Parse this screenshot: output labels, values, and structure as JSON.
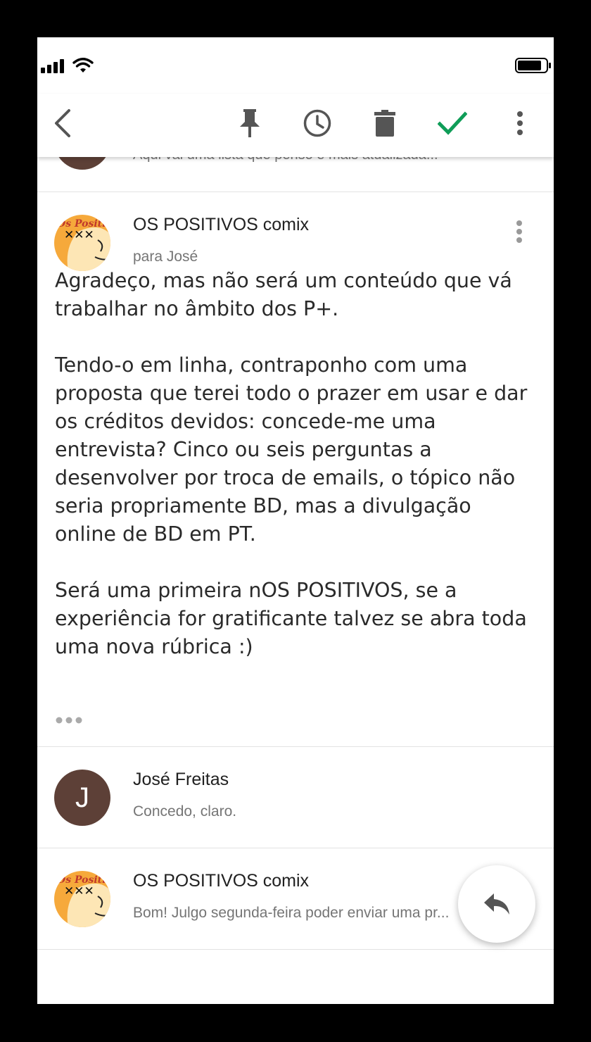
{
  "toolbar": {
    "back_icon": "arrow-back-icon",
    "pin_icon": "pin-icon",
    "snooze_icon": "clock-icon",
    "delete_icon": "trash-icon",
    "done_icon": "check-icon",
    "more_icon": "more-vert-icon",
    "accent": "#0f9d58"
  },
  "previous_message": {
    "snippet": "Aqui vai uma lista que penso é mais atualizada..."
  },
  "expanded_message": {
    "sender": "OS POSITIVOS comix",
    "recipient": "para José",
    "paragraphs": [
      "Agradeço, mas não será um conteúdo que vá trabalhar no âmbito dos P+.",
      "Tendo-o em linha, contraponho com uma proposta que terei todo o prazer em usar e dar os créditos devidos: concede-me uma entrevista? Cinco ou seis perguntas a desenvolver por troca de emails, o tópico não seria propriamente BD, mas a divulgação online de BD em PT.",
      "Será uma primeira nOS POSITIVOS, se a experiência for gratificante talvez se abra toda uma nova rúbrica :)"
    ]
  },
  "messages": [
    {
      "sender": "José Freitas",
      "snippet": "Concedo, claro.",
      "avatar_letter": "J",
      "avatar_color": "#5d4037"
    },
    {
      "sender": "OS POSITIVOS comix",
      "snippet": "Bom! Julgo segunda-feira poder enviar uma pr..."
    }
  ],
  "avatar_logo_text": "Os Positivos",
  "fab": {
    "icon": "reply-icon"
  }
}
